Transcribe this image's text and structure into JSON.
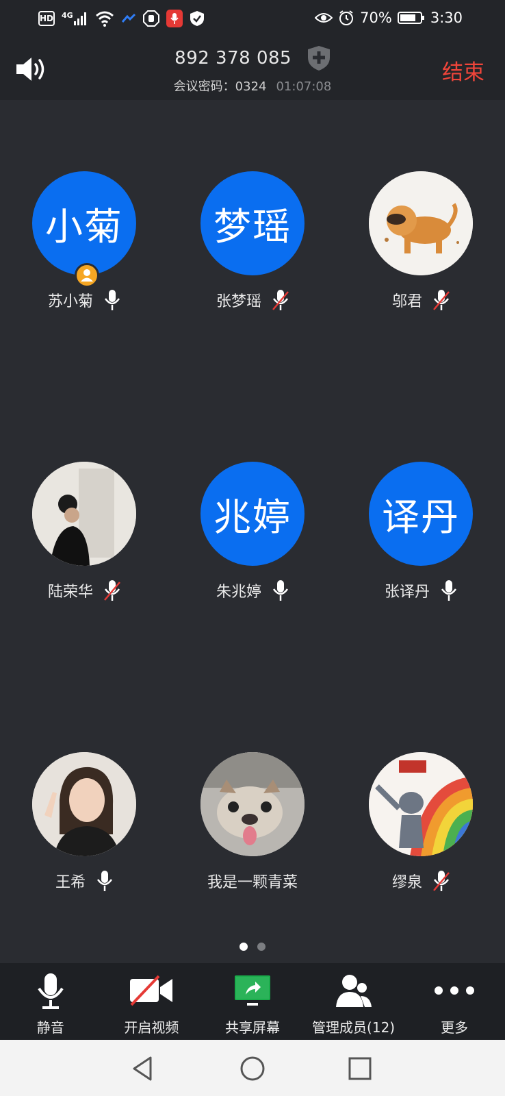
{
  "status_bar": {
    "hd_label": "HD",
    "network": "4G",
    "battery": "70%",
    "time": "3:30"
  },
  "header": {
    "meeting_id": "892 378 085",
    "password_label": "会议密码：",
    "password": "0324",
    "elapsed": "01:07:08",
    "end_label": "结束"
  },
  "participants": [
    {
      "name": "苏小菊",
      "avatar_text": "小菊",
      "avatar": "blue",
      "mic": "on",
      "host": true
    },
    {
      "name": "张梦瑶",
      "avatar_text": "梦瑶",
      "avatar": "blue",
      "mic": "muted"
    },
    {
      "name": "邬君",
      "avatar": "photo-cartoon-dog",
      "mic": "muted"
    },
    {
      "name": "陆荣华",
      "avatar": "photo-woman-artwork",
      "mic": "muted"
    },
    {
      "name": "朱兆婷",
      "avatar_text": "兆婷",
      "avatar": "blue",
      "mic": "on"
    },
    {
      "name": "张译丹",
      "avatar_text": "译丹",
      "avatar": "blue",
      "mic": "on"
    },
    {
      "name": "王希",
      "avatar": "photo-woman-selfie",
      "mic": "on"
    },
    {
      "name": "我是一颗青菜",
      "avatar": "photo-bulldog",
      "mic": "none"
    },
    {
      "name": "缪泉",
      "avatar": "photo-tom-cat-rainbow",
      "mic": "muted"
    }
  ],
  "pagination": {
    "pages": 2,
    "current": 1
  },
  "toolbar": {
    "mute_label": "静音",
    "video_label": "开启视频",
    "share_label": "共享屏幕",
    "members_label": "管理成员(12)",
    "more_label": "更多"
  },
  "colors": {
    "background": "#2a2c31",
    "avatar_blue": "#0a6ef0",
    "end_red": "#f0453a",
    "share_green": "#1aad4b",
    "mute_red": "#e53935"
  }
}
